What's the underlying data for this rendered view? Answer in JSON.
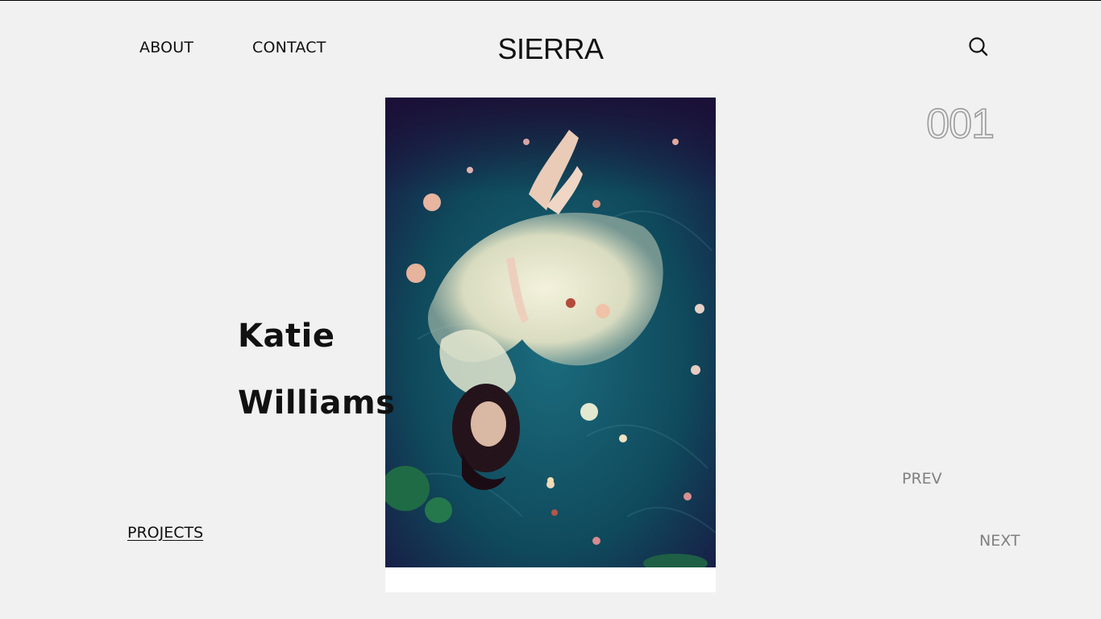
{
  "header": {
    "nav": [
      {
        "label": "ABOUT"
      },
      {
        "label": "CONTACT"
      }
    ],
    "brand": "SIERRA",
    "search_icon": "search-icon"
  },
  "project": {
    "number": "001",
    "first_name": "Katie",
    "last_name": "Williams"
  },
  "footer": {
    "projects_link": "PROJECTS",
    "prev_label": "PREV",
    "next_label": "NEXT"
  },
  "colors": {
    "background": "#f1f1f1",
    "text": "#111111",
    "muted": "#808080",
    "counter_outline": "#9b9b9b",
    "photo_water": "#0f4a5c"
  }
}
